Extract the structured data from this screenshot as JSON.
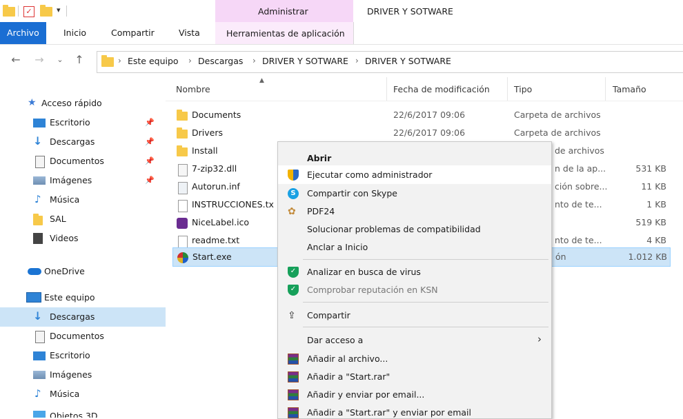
{
  "title_bar": {
    "manage_label": "Administrar",
    "window_title": "DRIVER Y SOTWARE"
  },
  "ribbon": {
    "tabs": [
      "Archivo",
      "Inicio",
      "Compartir",
      "Vista"
    ],
    "contextual_tab": "Herramientas de aplicación"
  },
  "address": {
    "crumbs": [
      "Este equipo",
      "Descargas",
      "DRIVER Y SOTWARE",
      "DRIVER Y SOTWARE"
    ]
  },
  "nav_pane": {
    "quick_access": "Acceso rápido",
    "quick_items": [
      "Escritorio",
      "Descargas",
      "Documentos",
      "Imágenes",
      "Música",
      "SAL",
      "Videos"
    ],
    "onedrive": "OneDrive",
    "this_pc": "Este equipo",
    "pc_items": [
      "Descargas",
      "Documentos",
      "Escritorio",
      "Imágenes",
      "Música",
      "Objetos 3D"
    ]
  },
  "columns": [
    "Nombre",
    "Fecha de modificación",
    "Tipo",
    "Tamaño"
  ],
  "files": [
    {
      "name": "Documents",
      "date": "22/6/2017 09:06",
      "type": "Carpeta de archivos",
      "size": ""
    },
    {
      "name": "Drivers",
      "date": "22/6/2017 09:06",
      "type": "Carpeta de archivos",
      "size": ""
    },
    {
      "name": "Install",
      "date": "",
      "type": "de archivos",
      "size": ""
    },
    {
      "name": "7-zip32.dll",
      "date": "",
      "type": "n de la ap...",
      "size": "531 KB"
    },
    {
      "name": "Autorun.inf",
      "date": "",
      "type": "ción sobre...",
      "size": "11 KB"
    },
    {
      "name": "INSTRUCCIONES.tx",
      "date": "",
      "type": "nto de te...",
      "size": "1 KB"
    },
    {
      "name": "NiceLabel.ico",
      "date": "",
      "type": "",
      "size": "519 KB"
    },
    {
      "name": "readme.txt",
      "date": "",
      "type": "nto de te...",
      "size": "4 KB"
    },
    {
      "name": "Start.exe",
      "date": "",
      "type": "ón",
      "size": "1.012 KB"
    }
  ],
  "context_menu": {
    "open": "Abrir",
    "run_admin": "Ejecutar como administrador",
    "skype": "Compartir con Skype",
    "pdf24": "PDF24",
    "compat": "Solucionar problemas de compatibilidad",
    "pin_start": "Anclar a Inicio",
    "scan": "Analizar en busca de virus",
    "ksn": "Comprobar reputación en KSN",
    "share": "Compartir",
    "give_access": "Dar acceso a",
    "add_archive": "Añadir al archivo...",
    "add_rar": "Añadir a \"Start.rar\"",
    "add_email": "Añadir y enviar por email...",
    "add_rar_email": "Añadir a \"Start.rar\" y enviar por email"
  }
}
